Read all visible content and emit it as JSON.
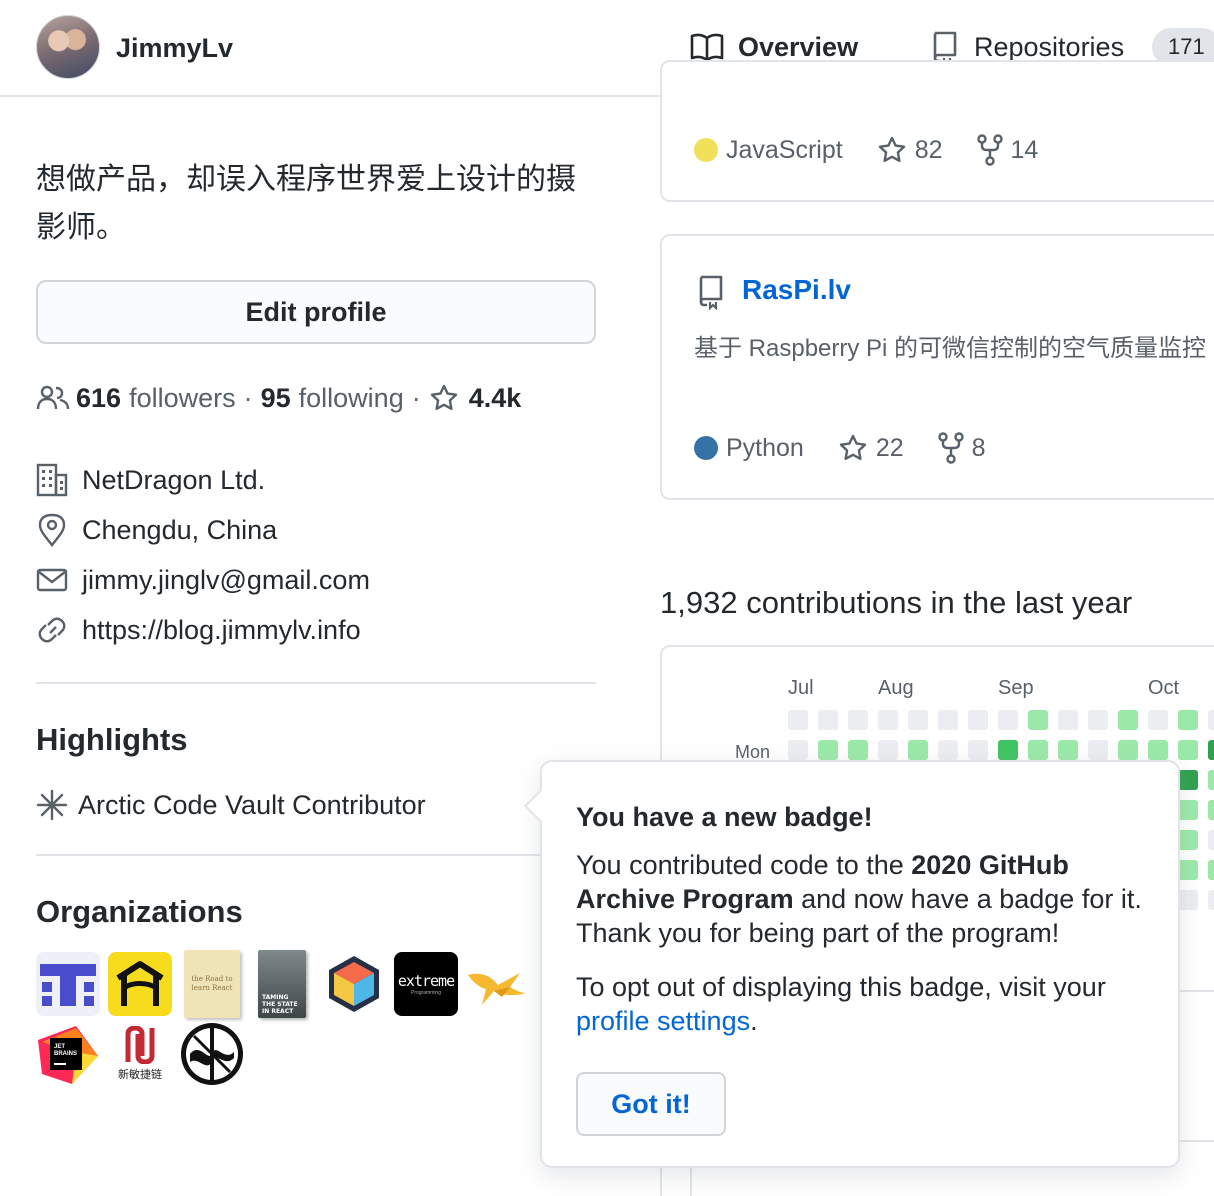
{
  "header": {
    "username": "JimmyLv",
    "tabs": [
      {
        "label": "Overview",
        "icon": "book-icon",
        "active": true
      },
      {
        "label": "Repositories",
        "icon": "repo-icon",
        "count": "171"
      }
    ]
  },
  "profile": {
    "bio": "想做产品，却误入程序世界爱上设计的摄影师。",
    "edit_button": "Edit profile",
    "stats": {
      "followers_count": "616",
      "followers_label": "followers",
      "sep1": "·",
      "following_count": "95",
      "following_label": "following",
      "sep2": "·",
      "stars": "4.4k"
    },
    "company": "NetDragon Ltd.",
    "location": "Chengdu, China",
    "email": "jimmy.jinglv@gmail.com",
    "website": "https://blog.jimmylv.info"
  },
  "highlights": {
    "title": "Highlights",
    "items": [
      "Arctic Code Vault Contributor"
    ]
  },
  "organizations": {
    "title": "Organizations",
    "logos": [
      {
        "name": "thoughtworks-t-logo",
        "text": ""
      },
      {
        "name": "house-logo",
        "text": ""
      },
      {
        "name": "road-to-learn-react-logo",
        "text": "the Road to learn React"
      },
      {
        "name": "taming-state-logo",
        "text": "TAMING THE STATE IN REACT"
      },
      {
        "name": "cube-logo",
        "text": ""
      },
      {
        "name": "extreme-programming-logo",
        "text": "extreme",
        "subtext": "Programming"
      },
      {
        "name": "yellow-bird-logo",
        "text": ""
      },
      {
        "name": "jetbrains-logo",
        "text": "JET BRAINS"
      },
      {
        "name": "xinmin-logo",
        "text": "新敏捷链"
      },
      {
        "name": "black-circle-logo",
        "text": ""
      }
    ]
  },
  "repos": [
    {
      "name": "",
      "description": "",
      "language": "JavaScript",
      "language_color": "#f1e05a",
      "stars": "82",
      "forks": "14"
    },
    {
      "name": "RasPi.lv",
      "description": "基于 Raspberry Pi 的可微信控制的空气质量监控",
      "language": "Python",
      "language_color": "#3572A5",
      "stars": "22",
      "forks": "8"
    }
  ],
  "contributions": {
    "title": "1,932 contributions in the last year",
    "months": [
      "Jul",
      "Aug",
      "Sep",
      "Oct"
    ],
    "day_label": "Mon",
    "colors": {
      "empty": "#ebedf0",
      "l1": "#9be9a8",
      "l2": "#40c463",
      "l3": "#30a14e"
    },
    "row1_levels": [
      0,
      0,
      0,
      0,
      0,
      0,
      0,
      0,
      1,
      0,
      0,
      1,
      0,
      1,
      0
    ],
    "row2_levels": [
      0,
      1,
      1,
      0,
      1,
      0,
      0,
      2,
      1,
      1,
      0,
      1,
      1,
      1,
      3
    ]
  },
  "badge_popover": {
    "title": "You have a new badge!",
    "body_prefix": "You contributed code to the ",
    "body_bold": "2020 GitHub Archive Program",
    "body_suffix": " and now have a badge for it. Thank you for being part of the program!",
    "optout_prefix": "To opt out of displaying this badge, visit your ",
    "optout_link": "profile settings",
    "optout_suffix": ".",
    "button": "Got it!"
  },
  "accent_colors": {
    "link": "#0366d6",
    "tab_underline": "#f9826c",
    "text": "#24292e",
    "muted": "#586069"
  }
}
